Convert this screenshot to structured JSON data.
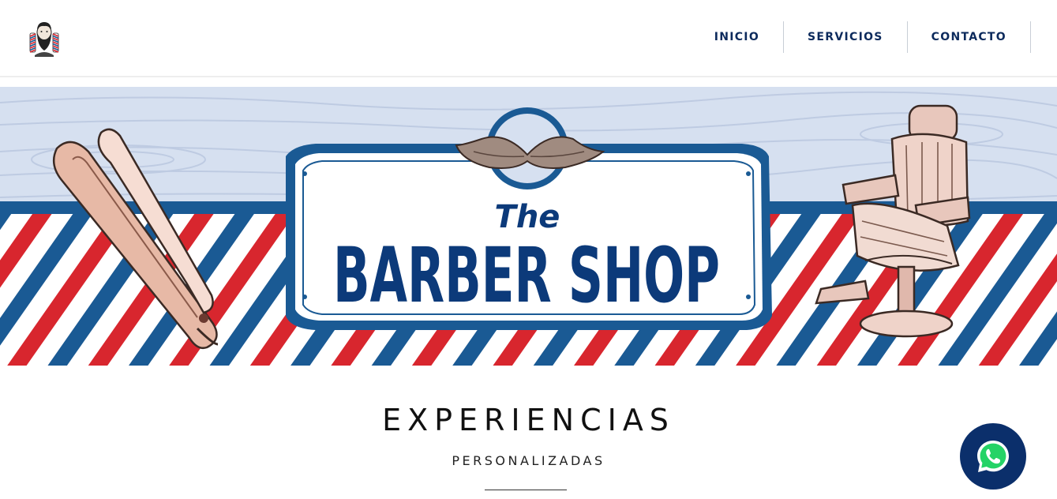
{
  "header": {
    "logo_icon": "bearded-barber-logo-icon",
    "nav": [
      {
        "label": "INICIO"
      },
      {
        "label": "SERVICIOS"
      },
      {
        "label": "CONTACTO"
      }
    ]
  },
  "hero": {
    "sign_small": "The",
    "sign_main": "BARBER SHOP",
    "icons": [
      "straight-razor-icon",
      "mustache-icon",
      "barber-chair-icon"
    ],
    "colors": {
      "blue": "#1a5a94",
      "red": "#d8262e",
      "navy": "#0c3a7a",
      "wood": "#d6e0f0"
    }
  },
  "content": {
    "title": "EXPERIENCIAS",
    "subtitle": "PERSONALIZADAS"
  },
  "whatsapp": {
    "icon": "whatsapp-icon",
    "color": "#0b2f6b"
  }
}
